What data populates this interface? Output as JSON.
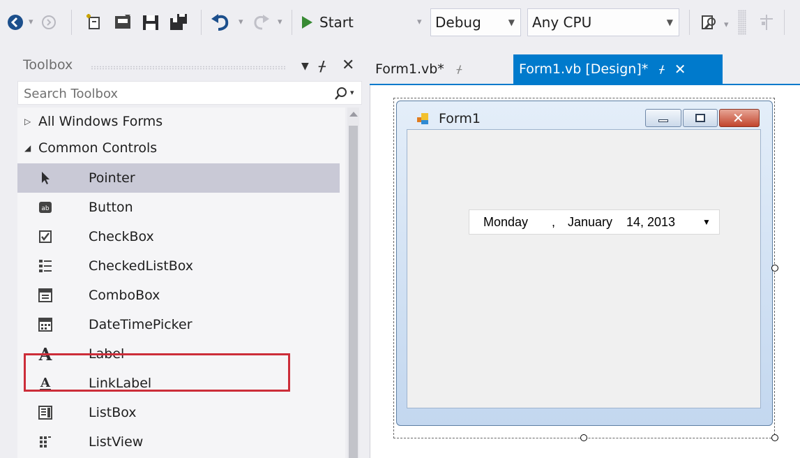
{
  "toolbar": {
    "start_label": "Start",
    "configuration": "Debug",
    "platform": "Any CPU"
  },
  "toolbox": {
    "title": "Toolbox",
    "search_placeholder": "Search Toolbox",
    "categories": [
      {
        "label": "All Windows Forms",
        "expanded": false
      },
      {
        "label": "Common Controls",
        "expanded": true
      }
    ],
    "items": [
      {
        "label": "Pointer",
        "icon": "pointer-icon",
        "selected": true
      },
      {
        "label": "Button",
        "icon": "button-icon"
      },
      {
        "label": "CheckBox",
        "icon": "checkbox-icon"
      },
      {
        "label": "CheckedListBox",
        "icon": "checkedlistbox-icon"
      },
      {
        "label": "ComboBox",
        "icon": "combobox-icon"
      },
      {
        "label": "DateTimePicker",
        "icon": "datetimepicker-icon",
        "highlighted": true
      },
      {
        "label": "Label",
        "icon": "label-icon"
      },
      {
        "label": "LinkLabel",
        "icon": "linklabel-icon"
      },
      {
        "label": "ListBox",
        "icon": "listbox-icon"
      },
      {
        "label": "ListView",
        "icon": "listview-icon"
      }
    ]
  },
  "tabs": [
    {
      "label": "Form1.vb*",
      "active": false
    },
    {
      "label": "Form1.vb [Design]*",
      "active": true
    }
  ],
  "designer": {
    "form_title": "Form1",
    "date_picker": {
      "day": "Monday",
      "separator": ",",
      "month": "January",
      "date_year": "14, 2013"
    }
  },
  "colors": {
    "accent": "#007acc",
    "highlight_box": "#cc2d39",
    "selected_item": "#c9c9d6"
  }
}
